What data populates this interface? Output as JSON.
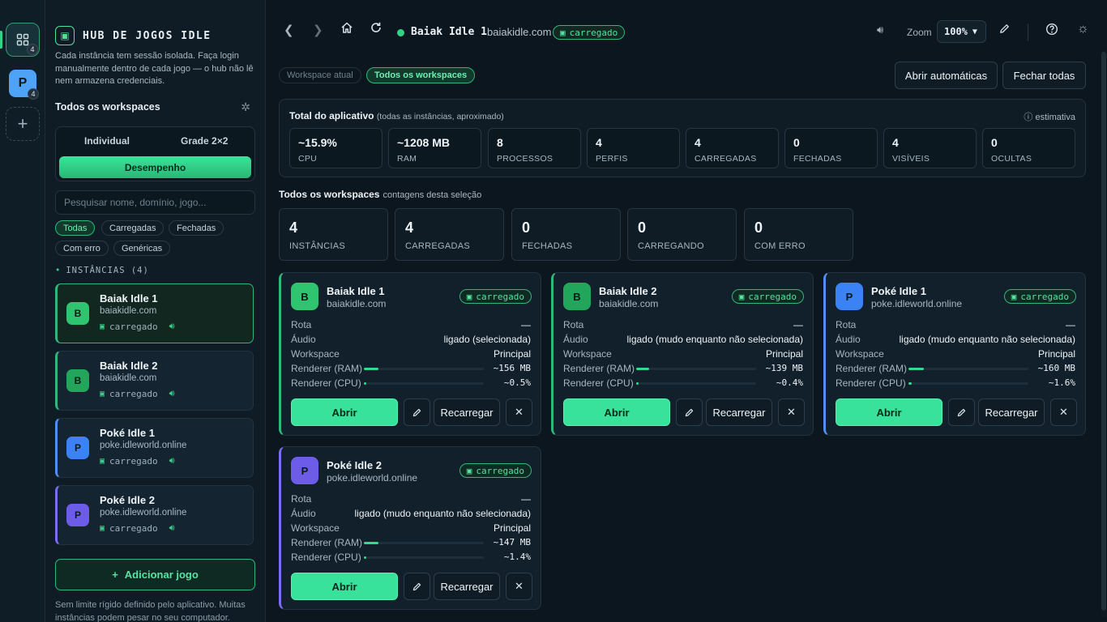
{
  "rail": {
    "workspace1_badge": "4",
    "workspace2_letter": "P",
    "workspace2_badge": "4",
    "add_symbol": "+"
  },
  "sidebar": {
    "title": "HUB DE JOGOS IDLE",
    "description": "Cada instância tem sessão isolada. Faça login manualmente dentro de cada jogo — o hub não lê nem armazena credenciais.",
    "workspaces_heading": "Todos os workspaces",
    "view_tabs": [
      "Individual",
      "Grade 2×2"
    ],
    "performance_button": "Desempenho",
    "search_placeholder": "Pesquisar nome, domínio, jogo...",
    "filters": [
      "Todas",
      "Carregadas",
      "Fechadas",
      "Com erro",
      "Genéricas"
    ],
    "instances_heading": "INSTÂNCIAS (4)",
    "instances": [
      {
        "letter": "B",
        "name": "Baiak Idle 1",
        "domain": "baiakidle.com",
        "status": "carregado",
        "color": "#2fc46f"
      },
      {
        "letter": "B",
        "name": "Baiak Idle 2",
        "domain": "baiakidle.com",
        "status": "carregado",
        "color": "#22a65c"
      },
      {
        "letter": "P",
        "name": "Poké Idle 1",
        "domain": "poke.idleworld.online",
        "status": "carregado",
        "color": "#3b82f6"
      },
      {
        "letter": "P",
        "name": "Poké Idle 2",
        "domain": "poke.idleworld.online",
        "status": "carregado",
        "color": "#6d5ce8"
      }
    ],
    "add_game_button": "Adicionar jogo",
    "footer_note": "Sem limite rígido definido pelo aplicativo. Muitas instâncias podem pesar no seu computador."
  },
  "topbar": {
    "page_title": "Baiak Idle 1",
    "page_domain": "baiakidle.com",
    "page_status": "carregado",
    "zoom_label": "Zoom",
    "zoom_value": "100%"
  },
  "main": {
    "workspace_filters": [
      "Workspace atual",
      "Todos os workspaces"
    ],
    "open_auto_button": "Abrir automáticas",
    "close_all_button": "Fechar todas",
    "totals_title": "Total do aplicativo",
    "totals_subtitle": "(todas as instâncias, aproximado)",
    "totals_estimate": "estimativa",
    "totals": [
      {
        "value": "~15.9%",
        "label": "CPU"
      },
      {
        "value": "~1208 MB",
        "label": "RAM"
      },
      {
        "value": "8",
        "label": "PROCESSOS"
      },
      {
        "value": "4",
        "label": "PERFIS"
      },
      {
        "value": "4",
        "label": "CARREGADAS"
      },
      {
        "value": "0",
        "label": "FECHADAS"
      },
      {
        "value": "4",
        "label": "VISÍVEIS"
      },
      {
        "value": "0",
        "label": "OCULTAS"
      }
    ],
    "selection_title": "Todos os workspaces",
    "selection_subtitle": "contagens desta seleção",
    "counts": [
      {
        "value": "4",
        "label": "INSTÂNCIAS"
      },
      {
        "value": "4",
        "label": "CARREGADAS"
      },
      {
        "value": "0",
        "label": "FECHADAS"
      },
      {
        "value": "0",
        "label": "CARREGANDO"
      },
      {
        "value": "0",
        "label": "COM ERRO"
      }
    ],
    "row_labels": {
      "route": "Rota",
      "audio": "Áudio",
      "workspace": "Workspace",
      "ram": "Renderer (RAM)",
      "cpu": "Renderer (CPU)"
    },
    "buttons": {
      "open": "Abrir",
      "reload": "Recarregar"
    },
    "cards": [
      {
        "letter": "B",
        "name": "Baiak Idle 1",
        "domain": "baiakidle.com",
        "status": "carregado",
        "route": "—",
        "audio": "ligado (selecionada)",
        "workspace": "Principal",
        "ram": "~156 MB",
        "ram_level": 0.12,
        "cpu": "~0.5%",
        "cpu_level": 0.02,
        "color": "#2fc46f"
      },
      {
        "letter": "B",
        "name": "Baiak Idle 2",
        "domain": "baiakidle.com",
        "status": "carregado",
        "route": "—",
        "audio": "ligado (mudo enquanto não selecionada)",
        "workspace": "Principal",
        "ram": "~139 MB",
        "ram_level": 0.11,
        "cpu": "~0.4%",
        "cpu_level": 0.02,
        "color": "#22a65c"
      },
      {
        "letter": "P",
        "name": "Poké Idle 1",
        "domain": "poke.idleworld.online",
        "status": "carregado",
        "route": "—",
        "audio": "ligado (mudo enquanto não selecionada)",
        "workspace": "Principal",
        "ram": "~160 MB",
        "ram_level": 0.13,
        "cpu": "~1.6%",
        "cpu_level": 0.03,
        "color": "#3b82f6"
      },
      {
        "letter": "P",
        "name": "Poké Idle 2",
        "domain": "poke.idleworld.online",
        "status": "carregado",
        "route": "—",
        "audio": "ligado (mudo enquanto não selecionada)",
        "workspace": "Principal",
        "ram": "~147 MB",
        "ram_level": 0.12,
        "cpu": "~1.4%",
        "cpu_level": 0.02,
        "color": "#6d5ce8"
      }
    ]
  }
}
